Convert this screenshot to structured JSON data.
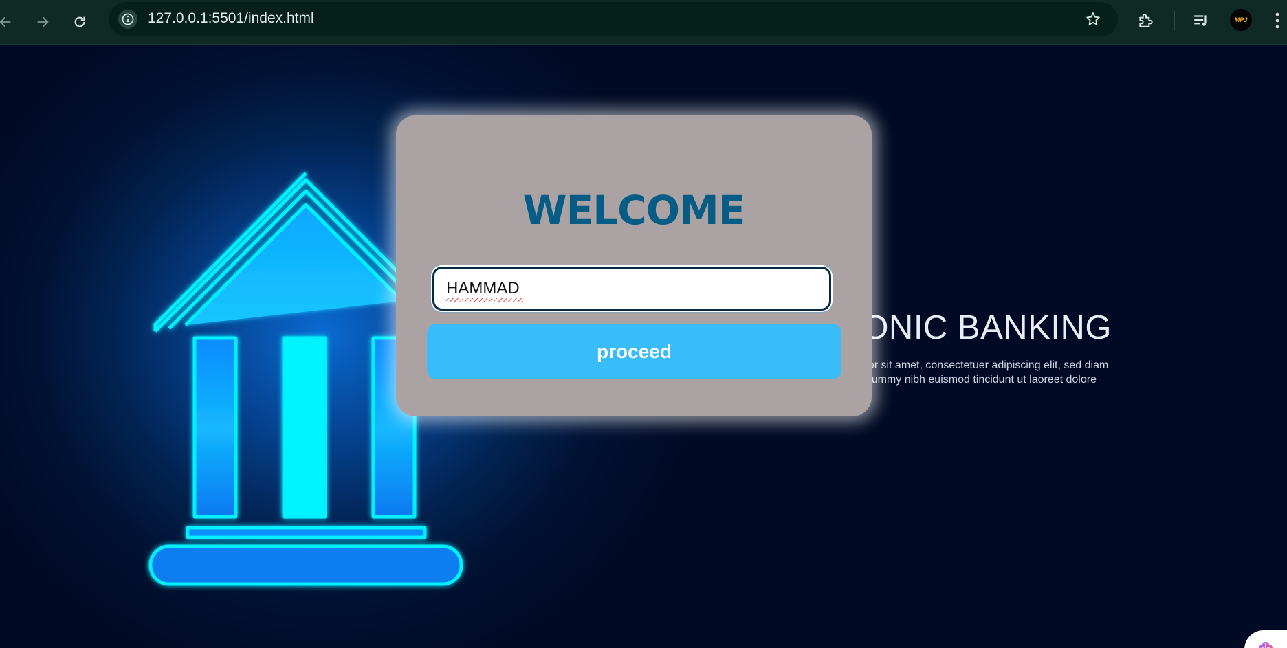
{
  "browser": {
    "url": "127.0.0.1:5501/index.html",
    "avatar_text": "MPJ"
  },
  "background": {
    "heading": "TRONIC BANKING",
    "subtext": "m dolor sit amet, consectetuer adipiscing elit, sed diam nonummy nibh euismod tincidunt ut laoreet dolore"
  },
  "login_card": {
    "title": "WELCOME",
    "name_value": "HAMMAD",
    "proceed_label": "proceed"
  },
  "colors": {
    "card_bg": "#aba3a3",
    "title": "#075c85",
    "button": "#38bdfa",
    "bank_glow": "#00f0ff"
  }
}
